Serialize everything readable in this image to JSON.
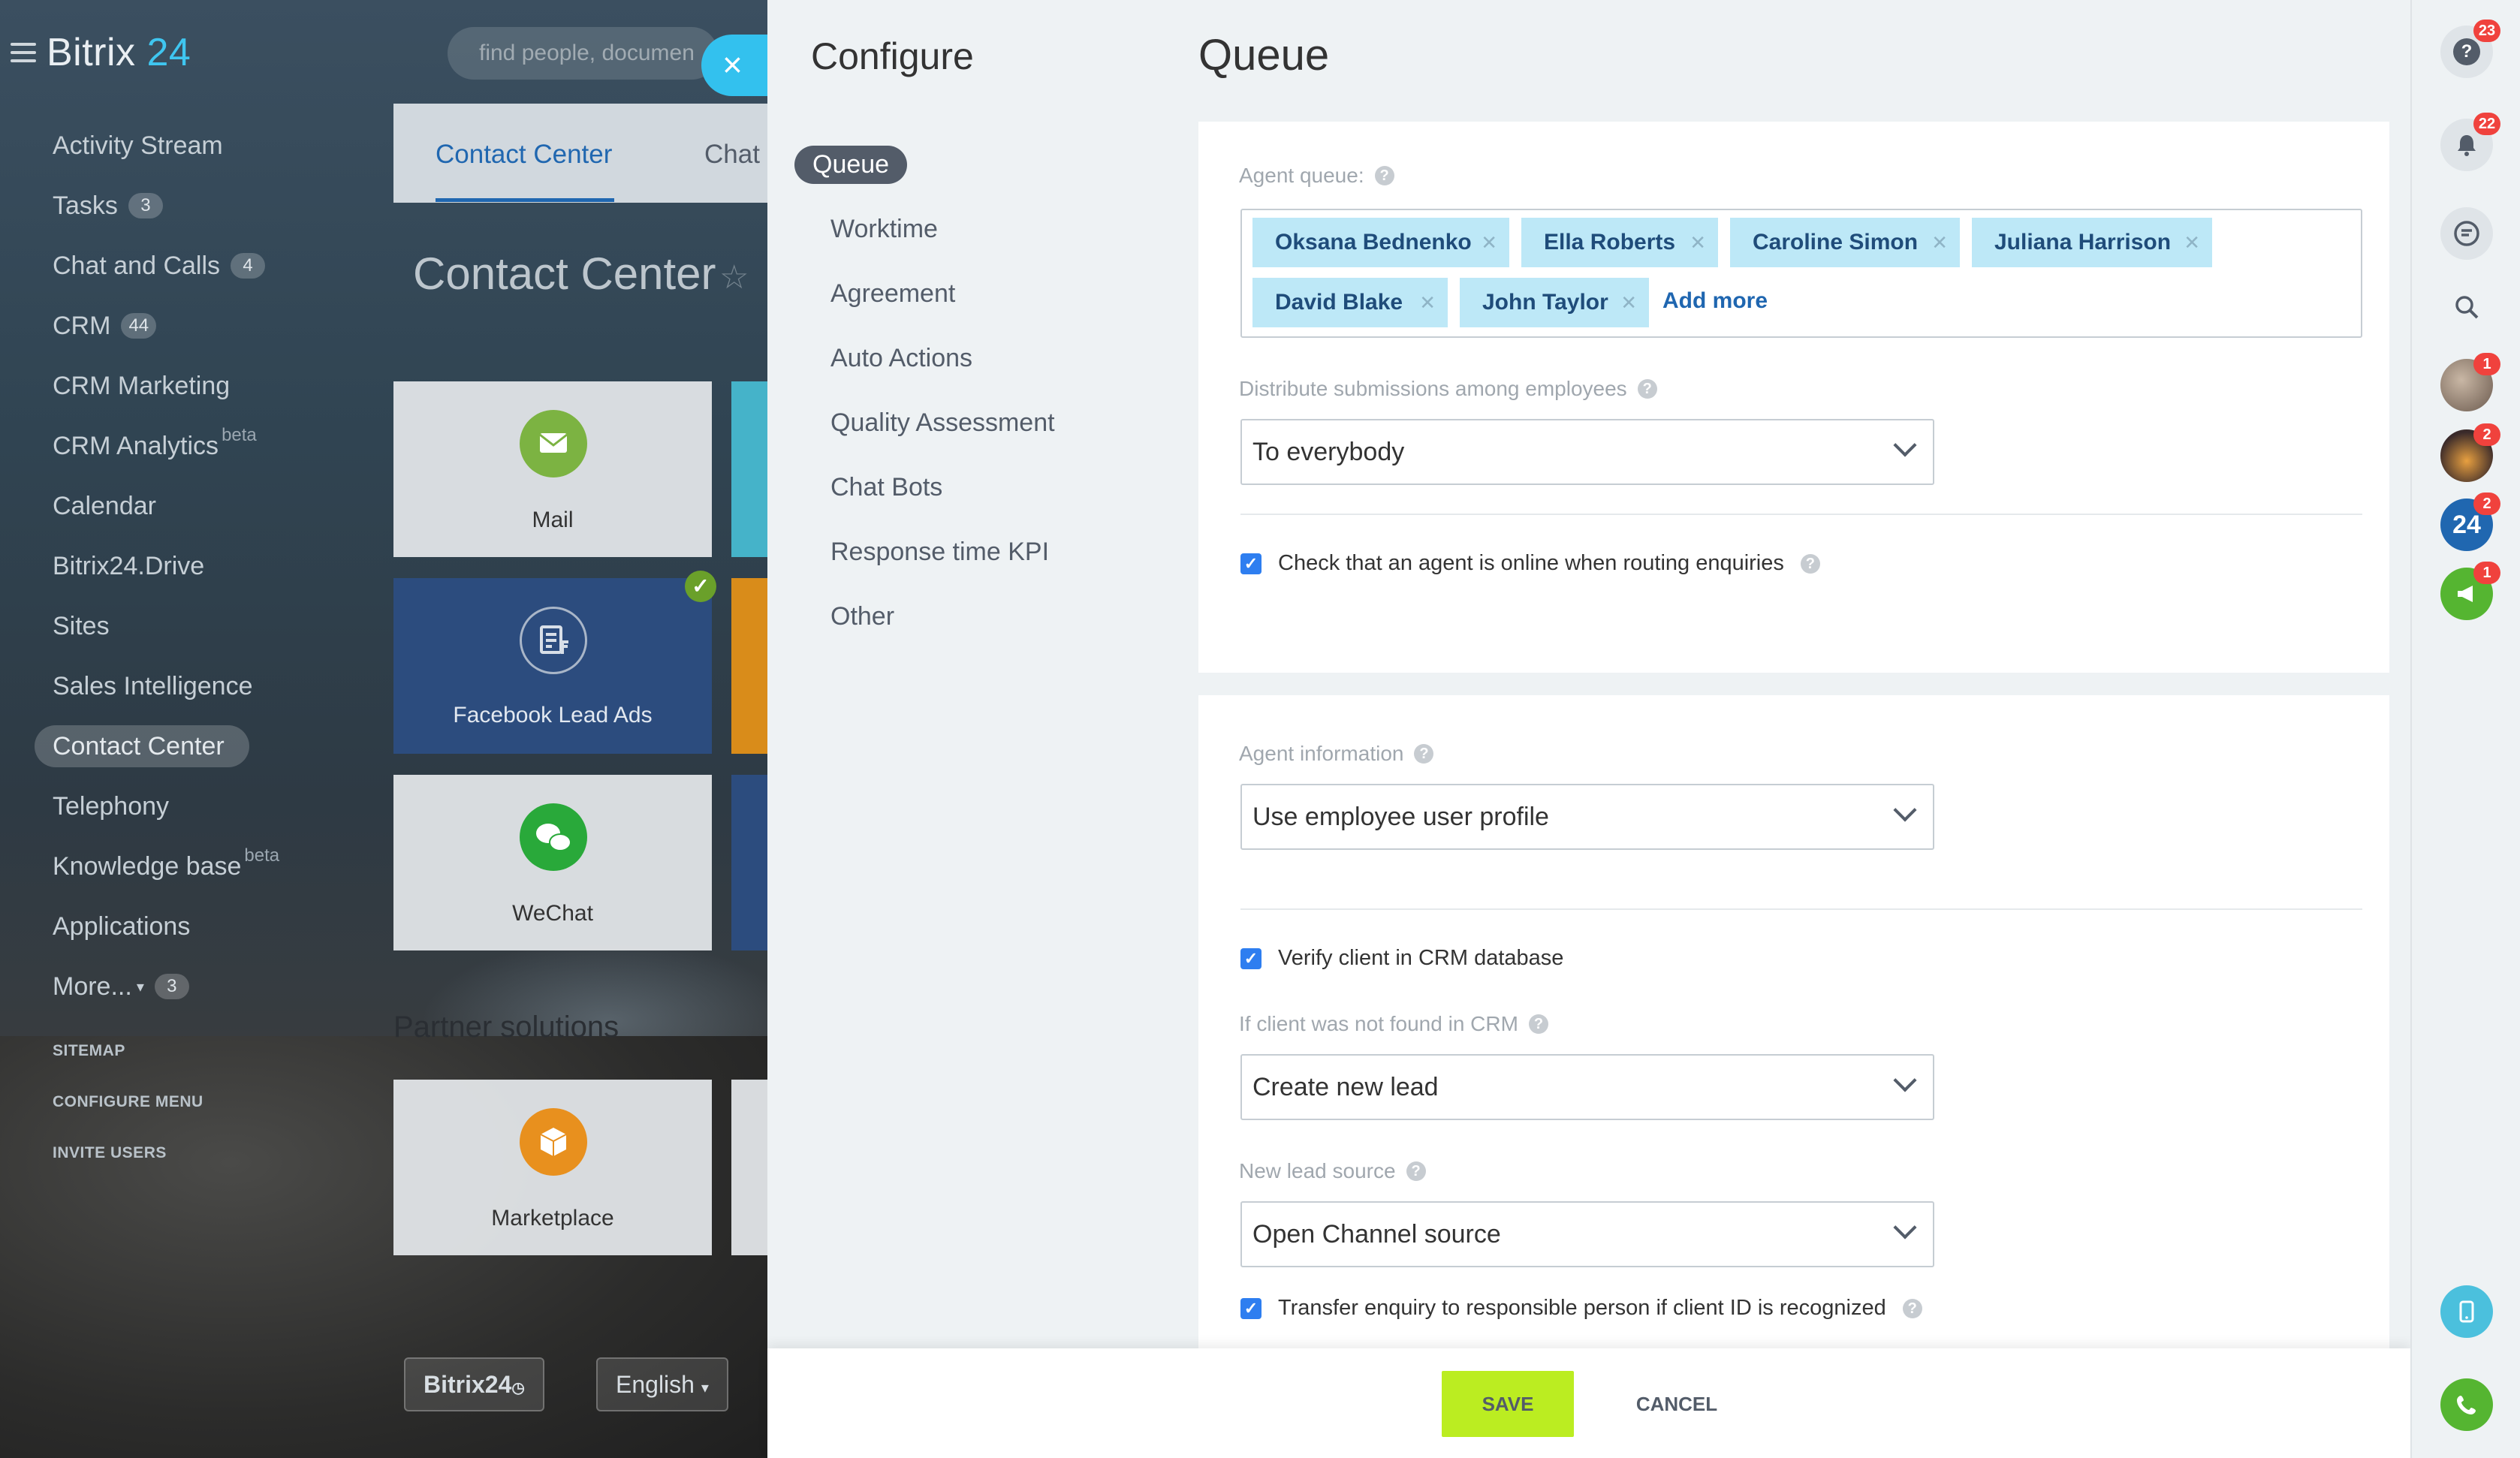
{
  "app": {
    "logo_main": "Bitrix",
    "logo_num": "24",
    "search_placeholder": "find people, documen"
  },
  "left_menu": {
    "items": [
      {
        "label": "Activity Stream",
        "count": ""
      },
      {
        "label": "Tasks",
        "count": "3"
      },
      {
        "label": "Chat and Calls",
        "count": "4"
      },
      {
        "label": "CRM",
        "count": "44"
      },
      {
        "label": "CRM Marketing",
        "count": ""
      },
      {
        "label": "CRM Analytics",
        "count": "",
        "sup": "beta"
      },
      {
        "label": "Calendar",
        "count": ""
      },
      {
        "label": "Bitrix24.Drive",
        "count": ""
      },
      {
        "label": "Sites",
        "count": ""
      },
      {
        "label": "Sales Intelligence",
        "count": ""
      },
      {
        "label": "Contact Center",
        "count": "",
        "active": true
      },
      {
        "label": "Telephony",
        "count": ""
      },
      {
        "label": "Knowledge base",
        "count": "",
        "sup": "beta"
      },
      {
        "label": "Applications",
        "count": ""
      },
      {
        "label": "More...",
        "count": "3"
      }
    ],
    "small": [
      "SITEMAP",
      "CONFIGURE MENU",
      "INVITE USERS"
    ]
  },
  "background_page": {
    "tabs": [
      "Contact Center",
      "Chat"
    ],
    "title": "Contact Center",
    "tiles": [
      "Mail",
      "Facebook Lead Ads",
      "WeChat",
      "Marketplace"
    ],
    "partner_title": "Partner solutions",
    "footer_logo": "Bitrix24",
    "language": "English"
  },
  "slider": {
    "title": "Configure",
    "nav": [
      "Queue",
      "Worktime",
      "Agreement",
      "Auto Actions",
      "Quality Assessment",
      "Chat Bots",
      "Response time KPI",
      "Other"
    ],
    "section_title": "Queue",
    "agent_queue_label": "Agent queue:",
    "agents": [
      "Oksana Bednenko",
      "Ella Roberts",
      "Caroline Simon",
      "Juliana Harrison",
      "David Blake",
      "John Taylor"
    ],
    "add_more": "Add more",
    "distribute_label": "Distribute submissions among employees",
    "distribute_value": "To everybody",
    "check_online": "Check that an agent is online when routing enquiries",
    "agent_info_label": "Agent information",
    "agent_info_value": "Use employee user profile",
    "verify_client": "Verify client in CRM database",
    "not_found_label": "If client was not found in CRM",
    "not_found_value": "Create new lead",
    "lead_source_label": "New lead source",
    "lead_source_value": "Open Channel source",
    "transfer": "Transfer enquiry to responsible person if client ID is recognized",
    "save": "SAVE",
    "cancel": "CANCEL"
  },
  "right_bar": {
    "help_badge": "23",
    "notif_badge": "22",
    "avatar_badges": [
      "1",
      "2",
      "2",
      "1"
    ],
    "b24": "24"
  },
  "colors": {
    "accent": "#33c1ee",
    "save": "#bbed21",
    "tag": "#bde8f7",
    "link": "#1f66b0"
  }
}
